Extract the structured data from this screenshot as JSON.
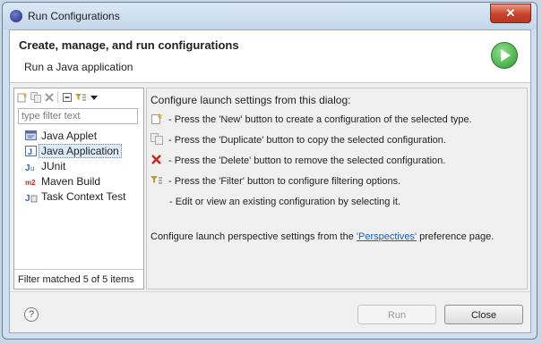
{
  "window": {
    "title": "Run Configurations",
    "close_glyph": "✕"
  },
  "header": {
    "title": "Create, manage, and run configurations",
    "subtitle": "Run a Java application",
    "icon": "run-play-icon"
  },
  "left": {
    "toolbar_icons": [
      "new-config-icon",
      "duplicate-icon",
      "delete-icon",
      "collapse-all-icon",
      "filter-icon",
      "view-menu-icon"
    ],
    "filter_placeholder": "type filter text",
    "items": [
      {
        "label": "Java Applet",
        "icon": "java-applet-icon",
        "selected": false
      },
      {
        "label": "Java Application",
        "icon": "java-application-icon",
        "selected": true
      },
      {
        "label": "JUnit",
        "icon": "junit-icon",
        "selected": false
      },
      {
        "label": "Maven Build",
        "icon": "maven-icon",
        "selected": false
      },
      {
        "label": "Task Context Test",
        "icon": "task-context-test-icon",
        "selected": false
      }
    ],
    "status": "Filter matched 5 of 5 items"
  },
  "right": {
    "intro": "Configure launch settings from this dialog:",
    "instructions": [
      {
        "icon": "new-config-icon",
        "text": "- Press the 'New' button to create a configuration of the selected type."
      },
      {
        "icon": "duplicate-icon",
        "text": "- Press the 'Duplicate' button to copy the selected configuration."
      },
      {
        "icon": "delete-icon",
        "text": "- Press the 'Delete' button to remove the selected configuration."
      },
      {
        "icon": "filter-icon",
        "text": "- Press the 'Filter' button to configure filtering options."
      },
      {
        "icon": "",
        "text": "- Edit or view an existing configuration by selecting it."
      }
    ],
    "perspectives": {
      "before": "Configure launch perspective settings from the ",
      "link": "'Perspectives'",
      "after": " preference page."
    }
  },
  "footer": {
    "help": "?",
    "run_label": "Run",
    "close_label": "Close"
  },
  "colors": {
    "accent_green": "#2f9a34",
    "link_blue": "#1f5fb3",
    "delete_red": "#d0201a",
    "selection": "#ddeaf8"
  }
}
